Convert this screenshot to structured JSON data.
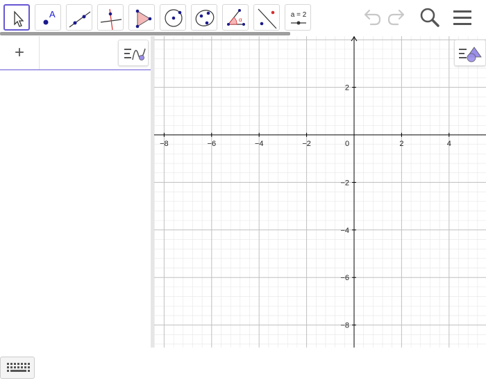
{
  "toolbar": {
    "tools": [
      {
        "name": "move-tool",
        "icon": "cursor-arrow-icon"
      },
      {
        "name": "point-tool",
        "icon": "point-label-icon",
        "label": "A"
      },
      {
        "name": "line-tool",
        "icon": "line-through-points-icon"
      },
      {
        "name": "perpendicular-tool",
        "icon": "perpendicular-line-icon"
      },
      {
        "name": "polygon-tool",
        "icon": "polygon-icon"
      },
      {
        "name": "circle-tool",
        "icon": "circle-center-point-icon"
      },
      {
        "name": "conic-tool",
        "icon": "ellipse-icon"
      },
      {
        "name": "angle-tool",
        "icon": "angle-icon",
        "label": "α"
      },
      {
        "name": "reflect-tool",
        "icon": "reflect-about-line-icon"
      },
      {
        "name": "slider-tool",
        "icon": "slider-icon",
        "label": "a = 2"
      }
    ],
    "undo_icon": "undo-icon",
    "redo_icon": "redo-icon",
    "search_icon": "search-icon",
    "menu_icon": "hamburger-menu-icon"
  },
  "algebra": {
    "add_label": "+",
    "style_icon": "algebra-style-icon",
    "keyboard_icon": "keyboard-icon"
  },
  "graphics": {
    "style_icon": "graphics-style-icon",
    "x_ticks": [
      "−8",
      "−6",
      "−4",
      "−2",
      "0",
      "2",
      "4"
    ],
    "y_ticks": [
      "2",
      "−2",
      "−4",
      "−6",
      "−8"
    ],
    "grid": true,
    "axis_color": "#000000",
    "major_grid_color": "#c0c0c0",
    "minor_grid_color": "#e6e6e6"
  },
  "colors": {
    "accent": "#6557d2",
    "point": "#1a1a8c",
    "polygon_fill": "#f4b8b8",
    "angle_color": "#d32f2f"
  }
}
